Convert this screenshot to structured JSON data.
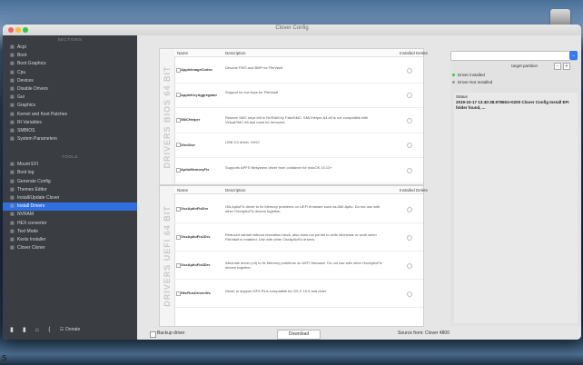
{
  "window": {
    "title": "Clover Config"
  },
  "sidebar": {
    "sections_header": "SECTIONS",
    "sections": [
      {
        "label": "Acpi",
        "icon": "grid-icon"
      },
      {
        "label": "Boot",
        "icon": "grid-icon"
      },
      {
        "label": "Boot Graphics",
        "icon": "grid-icon"
      },
      {
        "label": "Cpu",
        "icon": "grid-icon"
      },
      {
        "label": "Devices",
        "icon": "grid-icon"
      },
      {
        "label": "Disable Drivers",
        "icon": "grid-icon"
      },
      {
        "label": "Gui",
        "icon": "grid-icon"
      },
      {
        "label": "Graphics",
        "icon": "grid-icon"
      },
      {
        "label": "Kernel and Kext Patches",
        "icon": "grid-icon"
      },
      {
        "label": "Rt Variables",
        "icon": "grid-icon"
      },
      {
        "label": "SMBIOS",
        "icon": "grid-icon"
      },
      {
        "label": "System Parameters",
        "icon": "grid-icon"
      }
    ],
    "tools_header": "TOOLS",
    "tools": [
      {
        "label": "Mount EFI",
        "icon": "disk-icon"
      },
      {
        "label": "Boot log",
        "icon": "list-icon"
      },
      {
        "label": "Generate Config",
        "icon": "wand-icon"
      },
      {
        "label": "Themes Editor",
        "icon": "palette-icon"
      },
      {
        "label": "Install/Update Clover",
        "icon": "download-icon"
      },
      {
        "label": "Install Drivers",
        "icon": "wrench-icon",
        "active": true
      },
      {
        "label": "NVRAM",
        "icon": "chip-icon"
      },
      {
        "label": "HEX converter",
        "icon": "hex-icon"
      },
      {
        "label": "Text Mode",
        "icon": "text-icon"
      },
      {
        "label": "Kexts Installer",
        "icon": "gear-icon"
      },
      {
        "label": "Clover Cloner",
        "icon": "copy-icon"
      }
    ],
    "bottom": {
      "donate_label": "Donate"
    }
  },
  "bios_panel": {
    "title": "DRIVERS BIOS 64 BIT",
    "columns": [
      "Name",
      "Description",
      "Installed",
      "Delete"
    ],
    "rows": [
      {
        "name": "ApplelmageCodec",
        "desc": "Decode PNG and BMP for FileVault"
      },
      {
        "name": "AppleKeyAggregator",
        "desc": "Support for hot keys for FileVault"
      },
      {
        "name": "SMCHelper",
        "desc": "Restore SMC keys left in NVRAM by FakeSMC. SMCHelper-64.efi is not compatible with VirtualSMC.efi and must be removed."
      },
      {
        "name": "XhciDxe",
        "desc": "USB 3.0 driver, XHCI"
      },
      {
        "name": "AptioMemoryFix",
        "desc": "Supports APFS filesystem driver from container for macOS 10.13+"
      }
    ]
  },
  "uefi_panel": {
    "title": "DRIVERS UEFI 64 BIT",
    "columns": [
      "Name",
      "Description",
      "Installed",
      "Delete"
    ],
    "rows": [
      {
        "name": "OsxAptioFixDrv",
        "desc": "Old AptioFix driver to fix Memory problems on UEFI firmware such as AMI Aptio. Do not use with other OsxAptioFix drivers together."
      },
      {
        "name": "OsxAptioFix2Drv",
        "desc": "Reduced variant without relocation block, also does not permit to write hibernate or work when FileVault is enabled. Use with other OsxAptioFix drivers."
      },
      {
        "name": "OsxAptioFix3Drv",
        "desc": "Alternate driver (v3) to fix Memory problems on UEFI firmware. Do not use with other OsxAptioFix drivers together."
      },
      {
        "name": "HfsPlusDriverXfs",
        "desc": "Driver to support HFS Plus compatible for OS X 10.9 and older."
      }
    ]
  },
  "bottom_bar": {
    "backup_label": "Backup driver",
    "download_label": "Download",
    "source_label": "Source from: Clover 4800"
  },
  "right_panel": {
    "target_label": "target partition",
    "minus_label": "-",
    "plus_label": "+",
    "legend_installed": "Driver installed",
    "legend_not_installed": "Driver Not Installed",
    "status_title": "Status",
    "status_text": "2019-10-17 13:40:38.978651+0200 Clover Config Install EFI folder found, ...",
    "installed_color": "#34c759",
    "not_installed_color": "#9a9a9a"
  }
}
